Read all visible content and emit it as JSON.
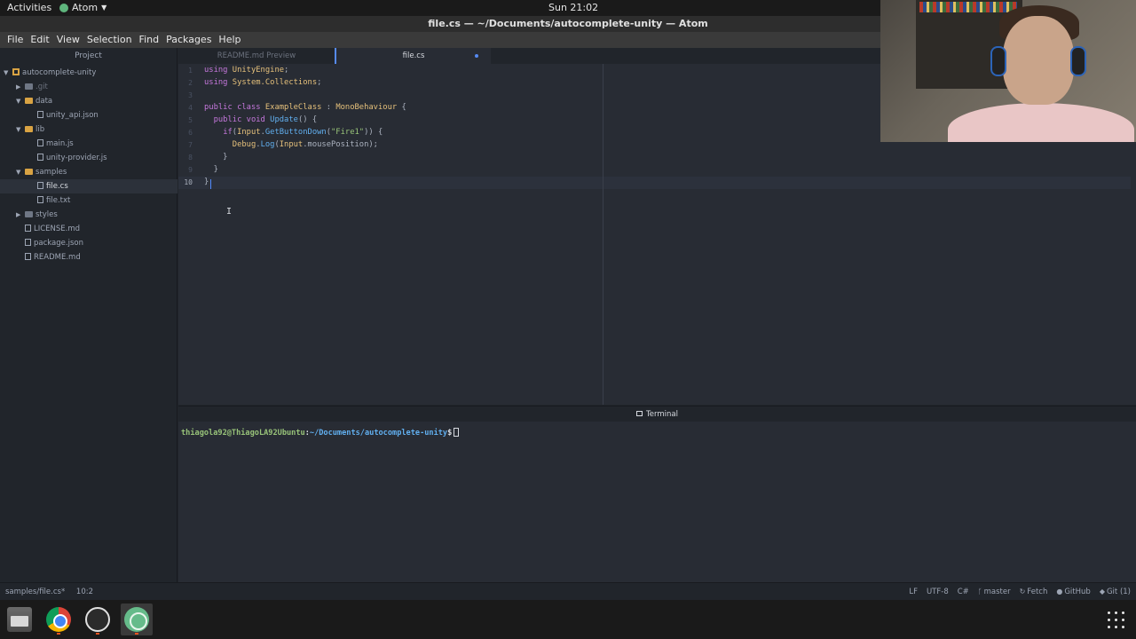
{
  "topbar": {
    "activities": "Activities",
    "app_menu": "Atom",
    "clock": "Sun 21:02"
  },
  "window": {
    "title": "file.cs — ~/Documents/autocomplete-unity — Atom"
  },
  "menu": [
    "File",
    "Edit",
    "View",
    "Selection",
    "Find",
    "Packages",
    "Help"
  ],
  "tree": {
    "title": "Project",
    "items": [
      {
        "label": "autocomplete-unity",
        "kind": "repo",
        "depth": 0,
        "expanded": true
      },
      {
        "label": ".git",
        "kind": "folder",
        "depth": 1,
        "expanded": false
      },
      {
        "label": "data",
        "kind": "folder",
        "depth": 1,
        "expanded": true
      },
      {
        "label": "unity_api.json",
        "kind": "file",
        "depth": 2
      },
      {
        "label": "lib",
        "kind": "folder",
        "depth": 1,
        "expanded": true
      },
      {
        "label": "main.js",
        "kind": "file",
        "depth": 2
      },
      {
        "label": "unity-provider.js",
        "kind": "file",
        "depth": 2
      },
      {
        "label": "samples",
        "kind": "folder",
        "depth": 1,
        "expanded": true
      },
      {
        "label": "file.cs",
        "kind": "file",
        "depth": 2,
        "selected": true
      },
      {
        "label": "file.txt",
        "kind": "file",
        "depth": 2
      },
      {
        "label": "styles",
        "kind": "folder",
        "depth": 1,
        "expanded": false
      },
      {
        "label": "LICENSE.md",
        "kind": "file",
        "depth": 1
      },
      {
        "label": "package.json",
        "kind": "file",
        "depth": 1
      },
      {
        "label": "README.md",
        "kind": "file",
        "depth": 1
      }
    ]
  },
  "tabs": [
    {
      "label": "README.md Preview",
      "active": false
    },
    {
      "label": "file.cs",
      "active": true,
      "modified": true
    }
  ],
  "editor": {
    "line_numbers": [
      "1",
      "2",
      "3",
      "4",
      "5",
      "6",
      "7",
      "8",
      "9",
      "10"
    ],
    "active_line": "10",
    "lines": [
      [
        [
          "kw",
          "using "
        ],
        [
          "ty",
          "UnityEngine"
        ],
        [
          "pl",
          ";"
        ]
      ],
      [
        [
          "kw",
          "using "
        ],
        [
          "ty",
          "System.Collections"
        ],
        [
          "pl",
          ";"
        ]
      ],
      [],
      [
        [
          "kw",
          "public class "
        ],
        [
          "ty",
          "ExampleClass"
        ],
        [
          "pl",
          " : "
        ],
        [
          "ty",
          "MonoBehaviour"
        ],
        [
          "pl",
          " {"
        ]
      ],
      [
        [
          "pl",
          "  "
        ],
        [
          "kw",
          "public void "
        ],
        [
          "fn",
          "Update"
        ],
        [
          "pl",
          "() {"
        ]
      ],
      [
        [
          "pl",
          "    "
        ],
        [
          "kw",
          "if"
        ],
        [
          "pl",
          "("
        ],
        [
          "ty",
          "Input"
        ],
        [
          "pl",
          "."
        ],
        [
          "fn",
          "GetButtonDown"
        ],
        [
          "pl",
          "("
        ],
        [
          "st",
          "\"Fire1\""
        ],
        [
          "pl",
          ")) {"
        ]
      ],
      [
        [
          "pl",
          "      "
        ],
        [
          "ty",
          "Debug"
        ],
        [
          "pl",
          "."
        ],
        [
          "fn",
          "Log"
        ],
        [
          "pl",
          "("
        ],
        [
          "ty",
          "Input"
        ],
        [
          "pl",
          ".mousePosition);"
        ]
      ],
      [
        [
          "pl",
          "    }"
        ]
      ],
      [
        [
          "pl",
          "  }"
        ]
      ],
      [
        [
          "pl",
          "}"
        ]
      ]
    ]
  },
  "terminal": {
    "header": "Terminal",
    "user_host": "thiagola92@ThiagoLA92Ubuntu",
    "separator": ":",
    "path": "~/Documents/autocomplete-unity",
    "symbol": "$"
  },
  "status": {
    "file": "samples/file.cs*",
    "cursor": "10:2",
    "line_ending": "LF",
    "encoding": "UTF-8",
    "grammar": "C#",
    "branch": "master",
    "fetch": "Fetch",
    "github": "GitHub",
    "git": "Git (1)"
  },
  "dock": [
    {
      "name": "files",
      "active": false
    },
    {
      "name": "chrome",
      "active": false
    },
    {
      "name": "obs",
      "active": false
    },
    {
      "name": "atom",
      "active": true
    }
  ],
  "colors": {
    "accent": "#568af2",
    "editor_bg": "#282c34",
    "panel_bg": "#21252b",
    "keyword": "#c678dd",
    "type": "#e5c07b",
    "function": "#61afef",
    "string": "#98c379"
  }
}
